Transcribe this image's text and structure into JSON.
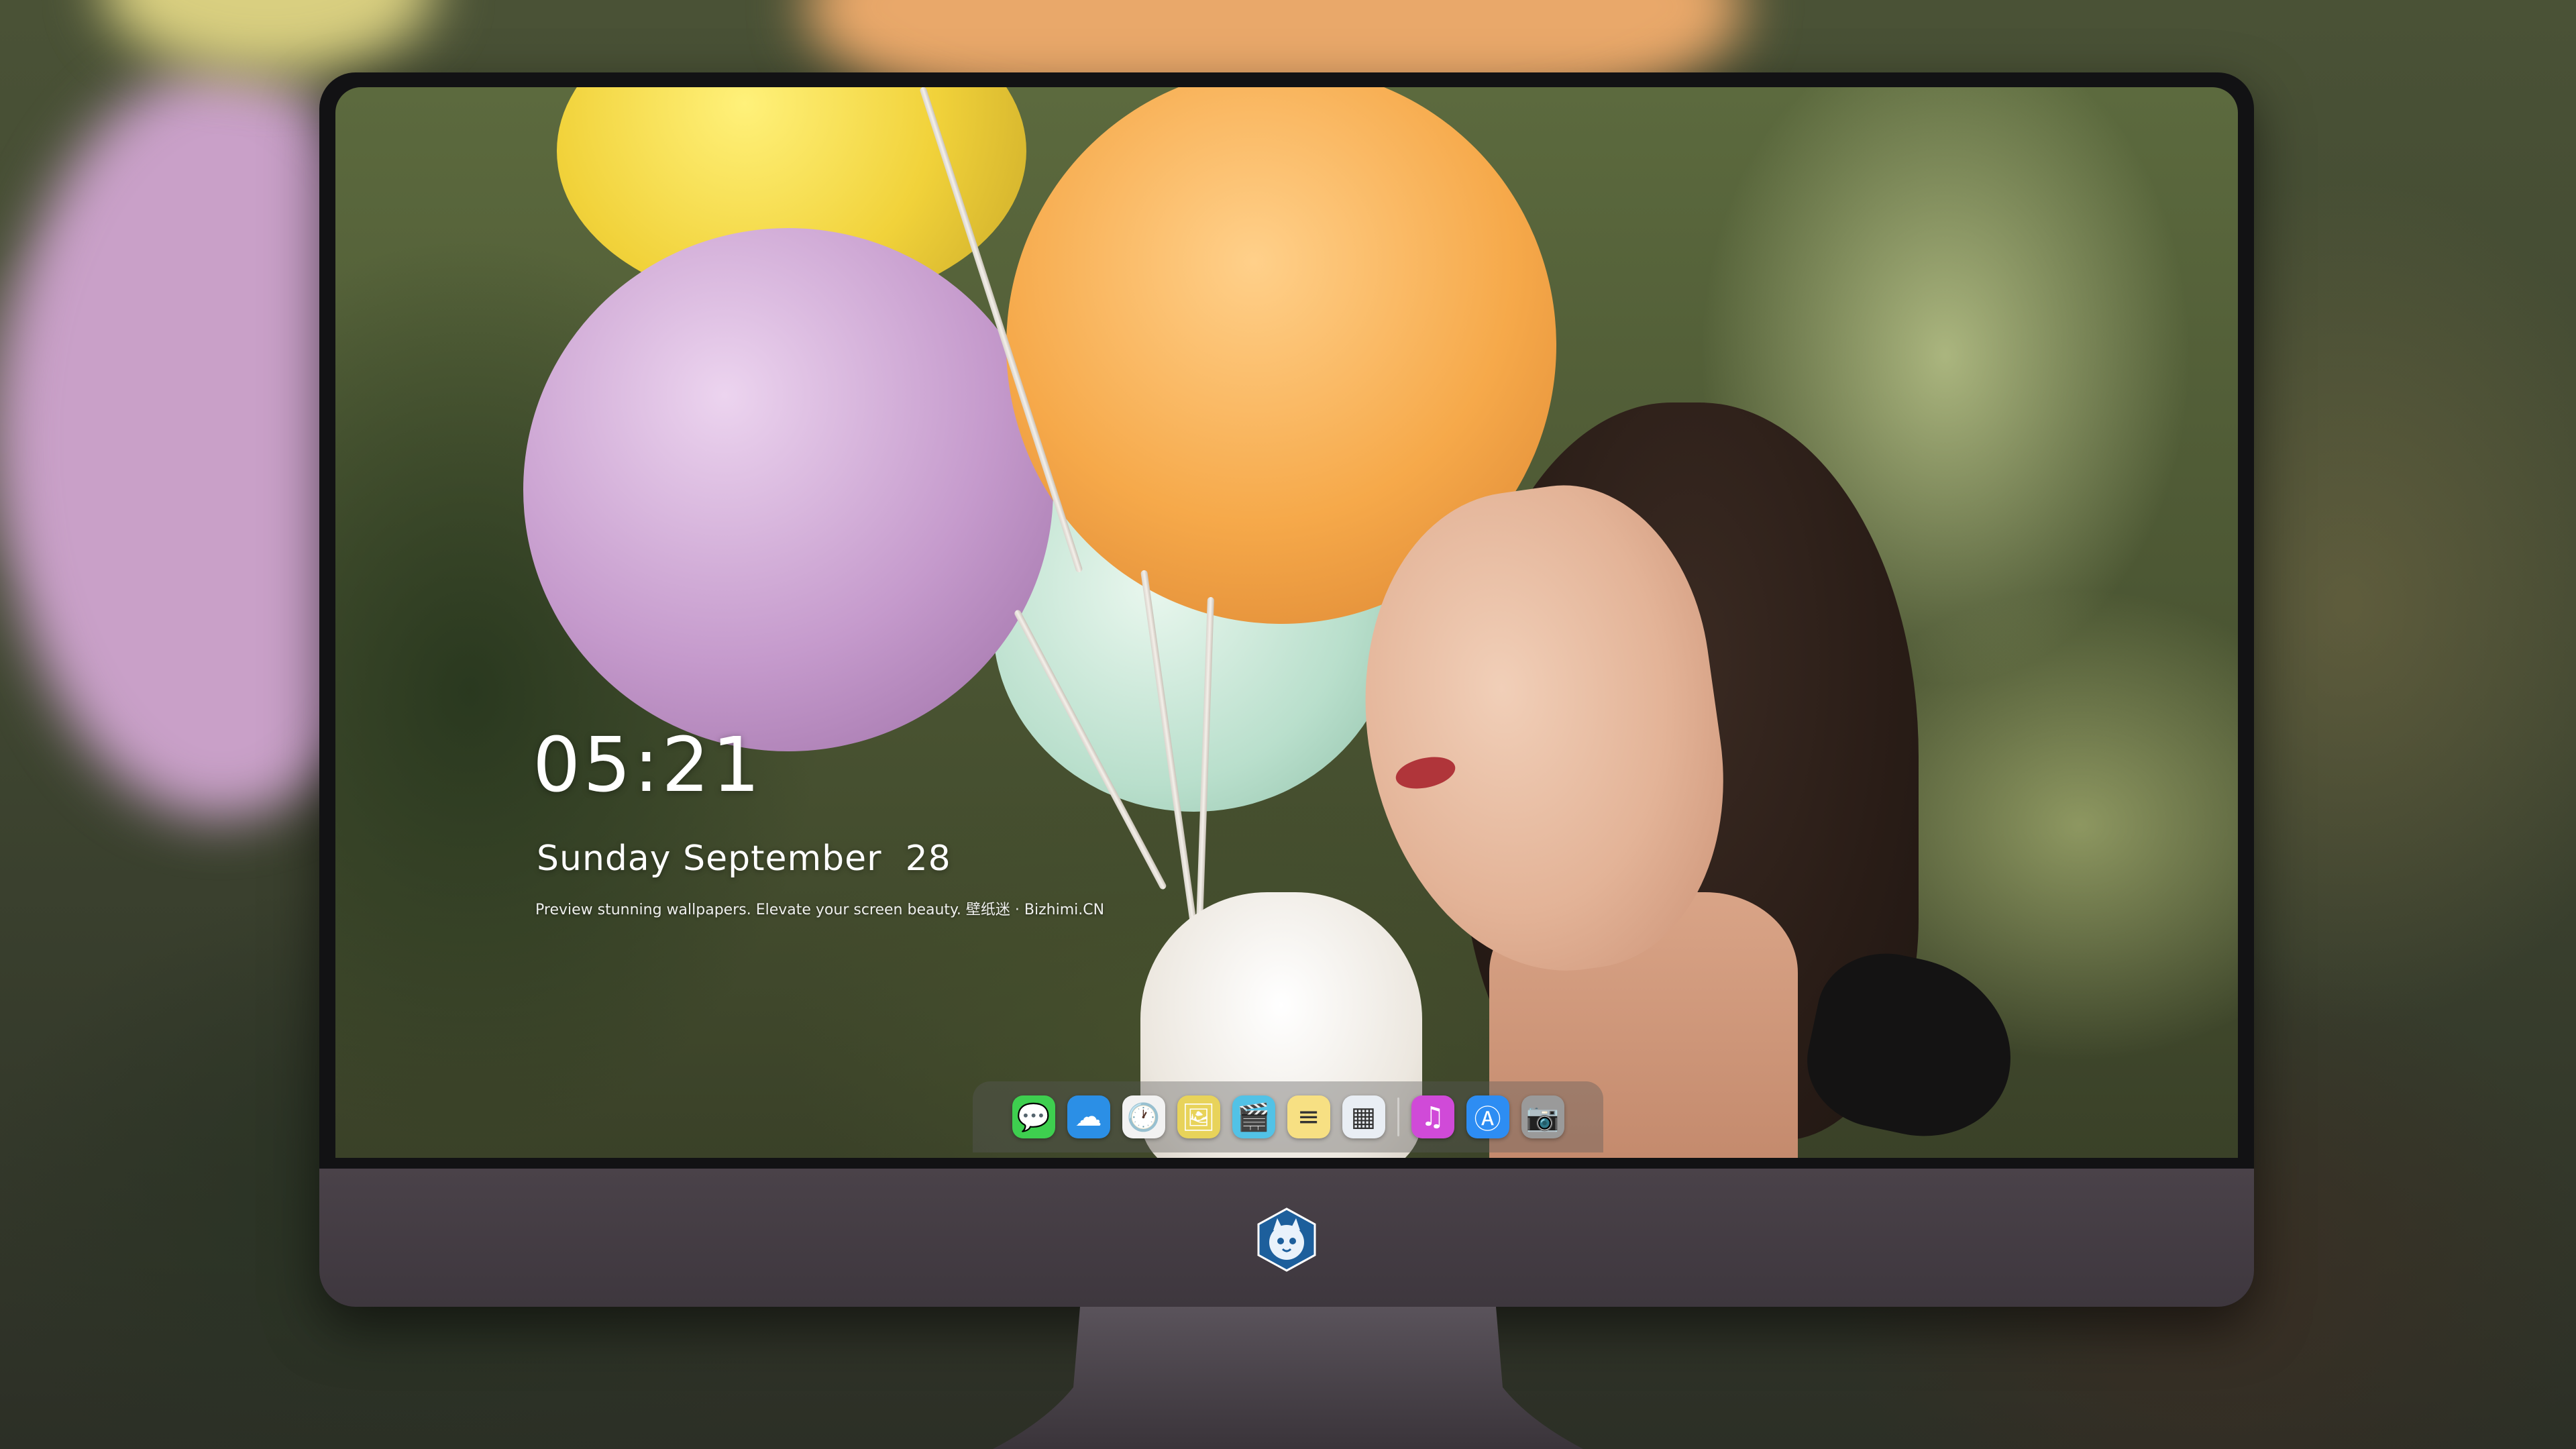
{
  "lockscreen": {
    "time": "05:21",
    "date": "Sunday September  28",
    "caption": "Preview stunning wallpapers. Elevate your screen beauty. 壁纸迷 · Bizhimi.CN"
  },
  "dock": {
    "apps": [
      {
        "name": "messages-icon",
        "glyph": "💬",
        "color": "#3ecf4f"
      },
      {
        "name": "weather-icon",
        "glyph": "☁",
        "color": "#2b8fe6"
      },
      {
        "name": "clock-icon",
        "glyph": "🕐",
        "color": "#f2f2f2"
      },
      {
        "name": "preview-icon",
        "glyph": "🖼",
        "color": "#e8d35a"
      },
      {
        "name": "clips-icon",
        "glyph": "🎬",
        "color": "#52c2e6"
      },
      {
        "name": "notes-icon",
        "glyph": "≡",
        "color": "#f7e083"
      },
      {
        "name": "photo-booth-icon",
        "glyph": "▦",
        "color": "#e9eef4"
      },
      {
        "name": "music-icon",
        "glyph": "♫",
        "color": "#d04ad8"
      },
      {
        "name": "app-store-icon",
        "glyph": "Ⓐ",
        "color": "#2d8df3"
      },
      {
        "name": "camera-icon",
        "glyph": "📷",
        "color": "#9a9a9a"
      }
    ]
  },
  "monitor": {
    "logo": "cat-logo-icon"
  }
}
